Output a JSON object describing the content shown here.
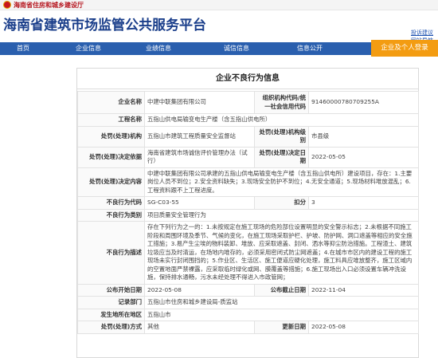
{
  "topbar": {
    "dept": "海南省住房和城乡建设厅"
  },
  "header": {
    "title": "海南省建筑市场监管公共服务平台",
    "links": [
      "投诉建议",
      "网站导航"
    ]
  },
  "nav": {
    "items": [
      "首页",
      "企业信息",
      "业绩信息",
      "诚信信息",
      "信息公开"
    ],
    "login": "企业及个人登录"
  },
  "card": {
    "title": "企业不良行为信息",
    "rows": {
      "company": {
        "label": "企业名称",
        "value": "中建中联集团有限公司"
      },
      "org_code": {
        "label": "组织机构代码/统一社会信用代码",
        "value": "91460000780709255A"
      },
      "project": {
        "label": "工程名称",
        "value": "五指山供电局输变电生产楼（含五指山供电所）"
      },
      "authority": {
        "label": "处罚(处理)机构",
        "value": "五指山市建筑工程质量安全监督站"
      },
      "authority_level": {
        "label": "处罚(处理)机构级别",
        "value": "市县级"
      },
      "basis": {
        "label": "处罚(处理)决定依据",
        "value": "海南省建筑市场诚信评价管理办法（试行）"
      },
      "decision_date": {
        "label": "处罚(处理)决定日期",
        "value": "2022-05-05"
      },
      "content": {
        "label": "处罚(处理)决定内容",
        "value": "中建中联集团有限公司承建的五指山供电局输变电生产楼（含五指山供电所）建设项目，存在：1.主要岗位人员不到位；2.安全资料缺失；3.现场安全防护不到位；4.无安全通道；5.现场材料堆放混乱；6.工程资料跟不上工程进度。"
      },
      "code": {
        "label": "不良行为代码",
        "value": "SG-C03-55"
      },
      "score_label": "扣分",
      "score": "3",
      "category": {
        "label": "不良行为类别",
        "value": "项目质量安全管理行为"
      },
      "description": {
        "label": "不良行为描述",
        "value": "存在下列行为之一的：1.未按规定在施工现场的危险部位设置明显的安全警示标志；2.未根据不同施工阶段和周围环境及季节、气候的变化，在施工现场采取护栏、护坡、防护网、洞口遮盖等相应的安全施工措施；3.易产生尘埃的物料装卸、堆放、应采取遮盖、封闭、洒水等抑尘防治措施。工程渣土、建筑垃圾应当及时清运，在场地内堆存的，必须采用密闭式防尘网遮盖；4.在城市市区内的建设工程的施工现场未实行封闭围挡的；5.作业区、生活区、施工便道应硬化处理，施工料具应堆放整齐，施工区域内的空置地面严禁裸露，应采取临时绿化或网、膜覆盖等措施；6.施工现场出入口必须设置车辆冲洗设施，保持排水通畅，污水未经处理不得进入市政管网；"
      },
      "publish_start": {
        "label": "公布开始日期",
        "value": "2022-05-08"
      },
      "publish_end": {
        "label": "公布截止日期",
        "value": "2022-11-04"
      },
      "record_dept": {
        "label": "记录部门",
        "value": "五指山市住房和城乡建设局-质监站"
      },
      "location": {
        "label": "发生地所在地区",
        "value": "五指山市"
      },
      "handling": {
        "label": "处罚(处理)方式",
        "value": "其他"
      },
      "update_date": {
        "label": "更新日期",
        "value": "2022-05-08"
      }
    }
  }
}
